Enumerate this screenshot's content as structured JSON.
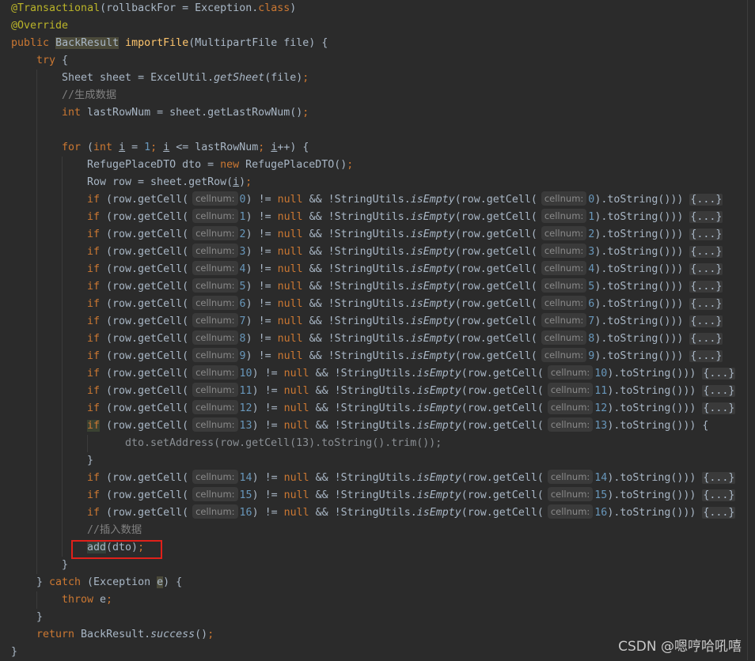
{
  "colors": {
    "background": "#2b2b2b",
    "keyword": "#cc7832",
    "annotation": "#bbb529",
    "method_decl": "#ffc66d",
    "text": "#a9b7c6",
    "number": "#6897bb",
    "comment": "#808080",
    "highlight_box": "#e0201a"
  },
  "watermark": "CSDN @嗯哼哈吼嘻",
  "lines": [
    {
      "indent": 0,
      "tokens": [
        [
          "ann",
          "@Transactional"
        ],
        [
          "p",
          "(rollbackFor = Exception."
        ],
        [
          "kw",
          "class"
        ],
        [
          "p",
          ")"
        ]
      ]
    },
    {
      "indent": 0,
      "tokens": [
        [
          "ann",
          "@Override"
        ]
      ]
    },
    {
      "indent": 0,
      "tokens": [
        [
          "kw",
          "public"
        ],
        [
          "p",
          " "
        ],
        [
          "hl",
          "BackResult"
        ],
        [
          "p",
          " "
        ],
        [
          "fn",
          "importFile"
        ],
        [
          "p",
          "(MultipartFile file) {"
        ]
      ]
    },
    {
      "indent": 1,
      "tokens": [
        [
          "kw",
          "try"
        ],
        [
          "p",
          " {"
        ]
      ]
    },
    {
      "indent": 2,
      "tokens": [
        [
          "p",
          "Sheet sheet = ExcelUtil."
        ],
        [
          "it",
          "getSheet"
        ],
        [
          "p",
          "(file)"
        ],
        [
          "kw",
          ";"
        ]
      ]
    },
    {
      "indent": 2,
      "tokens": [
        [
          "cm",
          "//生成数据"
        ]
      ]
    },
    {
      "indent": 2,
      "tokens": [
        [
          "kw",
          "int"
        ],
        [
          "p",
          " lastRowNum = sheet.getLastRowNum()"
        ],
        [
          "kw",
          ";"
        ]
      ]
    },
    {
      "indent": 2,
      "tokens": []
    },
    {
      "indent": 2,
      "tokens": [
        [
          "kw",
          "for"
        ],
        [
          "p",
          " ("
        ],
        [
          "kw",
          "int"
        ],
        [
          "p",
          " "
        ],
        [
          "ul",
          "i"
        ],
        [
          "p",
          " = "
        ],
        [
          "num",
          "1"
        ],
        [
          "kw",
          ";"
        ],
        [
          "p",
          " "
        ],
        [
          "ul",
          "i"
        ],
        [
          "p",
          " <= lastRowNum"
        ],
        [
          "kw",
          ";"
        ],
        [
          "p",
          " "
        ],
        [
          "ul",
          "i"
        ],
        [
          "p",
          "++) {"
        ]
      ]
    },
    {
      "indent": 3,
      "tokens": [
        [
          "p",
          "RefugePlaceDTO dto = "
        ],
        [
          "kw",
          "new"
        ],
        [
          "p",
          " RefugePlaceDTO()"
        ],
        [
          "kw",
          ";"
        ]
      ]
    },
    {
      "indent": 3,
      "tokens": [
        [
          "p",
          "Row row = sheet.getRow("
        ],
        [
          "ul",
          "i"
        ],
        [
          "p",
          ")"
        ],
        [
          "kw",
          ";"
        ]
      ]
    },
    {
      "indent": 3,
      "tokens": [
        [
          "kw",
          "if"
        ],
        [
          "p",
          " (row.getCell("
        ],
        [
          "hint",
          "cellnum:"
        ],
        [
          "num",
          "0"
        ],
        [
          "p",
          ") != "
        ],
        [
          "kw",
          "null"
        ],
        [
          "p",
          " && !StringUtils."
        ],
        [
          "it",
          "isEmpty"
        ],
        [
          "p",
          "(row.getCell("
        ],
        [
          "hint",
          "cellnum:"
        ],
        [
          "num",
          "0"
        ],
        [
          "p",
          ").toString())) "
        ],
        [
          "fold",
          "{...}"
        ]
      ]
    },
    {
      "indent": 3,
      "tokens": [
        [
          "kw",
          "if"
        ],
        [
          "p",
          " (row.getCell("
        ],
        [
          "hint",
          "cellnum:"
        ],
        [
          "num",
          "1"
        ],
        [
          "p",
          ") != "
        ],
        [
          "kw",
          "null"
        ],
        [
          "p",
          " && !StringUtils."
        ],
        [
          "it",
          "isEmpty"
        ],
        [
          "p",
          "(row.getCell("
        ],
        [
          "hint",
          "cellnum:"
        ],
        [
          "num",
          "1"
        ],
        [
          "p",
          ").toString())) "
        ],
        [
          "fold",
          "{...}"
        ]
      ]
    },
    {
      "indent": 3,
      "tokens": [
        [
          "kw",
          "if"
        ],
        [
          "p",
          " (row.getCell("
        ],
        [
          "hint",
          "cellnum:"
        ],
        [
          "num",
          "2"
        ],
        [
          "p",
          ") != "
        ],
        [
          "kw",
          "null"
        ],
        [
          "p",
          " && !StringUtils."
        ],
        [
          "it",
          "isEmpty"
        ],
        [
          "p",
          "(row.getCell("
        ],
        [
          "hint",
          "cellnum:"
        ],
        [
          "num",
          "2"
        ],
        [
          "p",
          ").toString())) "
        ],
        [
          "fold",
          "{...}"
        ]
      ]
    },
    {
      "indent": 3,
      "tokens": [
        [
          "kw",
          "if"
        ],
        [
          "p",
          " (row.getCell("
        ],
        [
          "hint",
          "cellnum:"
        ],
        [
          "num",
          "3"
        ],
        [
          "p",
          ") != "
        ],
        [
          "kw",
          "null"
        ],
        [
          "p",
          " && !StringUtils."
        ],
        [
          "it",
          "isEmpty"
        ],
        [
          "p",
          "(row.getCell("
        ],
        [
          "hint",
          "cellnum:"
        ],
        [
          "num",
          "3"
        ],
        [
          "p",
          ").toString())) "
        ],
        [
          "fold",
          "{...}"
        ]
      ]
    },
    {
      "indent": 3,
      "tokens": [
        [
          "kw",
          "if"
        ],
        [
          "p",
          " (row.getCell("
        ],
        [
          "hint",
          "cellnum:"
        ],
        [
          "num",
          "4"
        ],
        [
          "p",
          ") != "
        ],
        [
          "kw",
          "null"
        ],
        [
          "p",
          " && !StringUtils."
        ],
        [
          "it",
          "isEmpty"
        ],
        [
          "p",
          "(row.getCell("
        ],
        [
          "hint",
          "cellnum:"
        ],
        [
          "num",
          "4"
        ],
        [
          "p",
          ").toString())) "
        ],
        [
          "fold",
          "{...}"
        ]
      ]
    },
    {
      "indent": 3,
      "tokens": [
        [
          "kw",
          "if"
        ],
        [
          "p",
          " (row.getCell("
        ],
        [
          "hint",
          "cellnum:"
        ],
        [
          "num",
          "5"
        ],
        [
          "p",
          ") != "
        ],
        [
          "kw",
          "null"
        ],
        [
          "p",
          " && !StringUtils."
        ],
        [
          "it",
          "isEmpty"
        ],
        [
          "p",
          "(row.getCell("
        ],
        [
          "hint",
          "cellnum:"
        ],
        [
          "num",
          "5"
        ],
        [
          "p",
          ").toString())) "
        ],
        [
          "fold",
          "{...}"
        ]
      ]
    },
    {
      "indent": 3,
      "tokens": [
        [
          "kw",
          "if"
        ],
        [
          "p",
          " (row.getCell("
        ],
        [
          "hint",
          "cellnum:"
        ],
        [
          "num",
          "6"
        ],
        [
          "p",
          ") != "
        ],
        [
          "kw",
          "null"
        ],
        [
          "p",
          " && !StringUtils."
        ],
        [
          "it",
          "isEmpty"
        ],
        [
          "p",
          "(row.getCell("
        ],
        [
          "hint",
          "cellnum:"
        ],
        [
          "num",
          "6"
        ],
        [
          "p",
          ").toString())) "
        ],
        [
          "fold",
          "{...}"
        ]
      ]
    },
    {
      "indent": 3,
      "tokens": [
        [
          "kw",
          "if"
        ],
        [
          "p",
          " (row.getCell("
        ],
        [
          "hint",
          "cellnum:"
        ],
        [
          "num",
          "7"
        ],
        [
          "p",
          ") != "
        ],
        [
          "kw",
          "null"
        ],
        [
          "p",
          " && !StringUtils."
        ],
        [
          "it",
          "isEmpty"
        ],
        [
          "p",
          "(row.getCell("
        ],
        [
          "hint",
          "cellnum:"
        ],
        [
          "num",
          "7"
        ],
        [
          "p",
          ").toString())) "
        ],
        [
          "fold",
          "{...}"
        ]
      ]
    },
    {
      "indent": 3,
      "tokens": [
        [
          "kw",
          "if"
        ],
        [
          "p",
          " (row.getCell("
        ],
        [
          "hint",
          "cellnum:"
        ],
        [
          "num",
          "8"
        ],
        [
          "p",
          ") != "
        ],
        [
          "kw",
          "null"
        ],
        [
          "p",
          " && !StringUtils."
        ],
        [
          "it",
          "isEmpty"
        ],
        [
          "p",
          "(row.getCell("
        ],
        [
          "hint",
          "cellnum:"
        ],
        [
          "num",
          "8"
        ],
        [
          "p",
          ").toString())) "
        ],
        [
          "fold",
          "{...}"
        ]
      ]
    },
    {
      "indent": 3,
      "tokens": [
        [
          "kw",
          "if"
        ],
        [
          "p",
          " (row.getCell("
        ],
        [
          "hint",
          "cellnum:"
        ],
        [
          "num",
          "9"
        ],
        [
          "p",
          ") != "
        ],
        [
          "kw",
          "null"
        ],
        [
          "p",
          " && !StringUtils."
        ],
        [
          "it",
          "isEmpty"
        ],
        [
          "p",
          "(row.getCell("
        ],
        [
          "hint",
          "cellnum:"
        ],
        [
          "num",
          "9"
        ],
        [
          "p",
          ").toString())) "
        ],
        [
          "fold",
          "{...}"
        ]
      ]
    },
    {
      "indent": 3,
      "tokens": [
        [
          "kw",
          "if"
        ],
        [
          "p",
          " (row.getCell("
        ],
        [
          "hint",
          "cellnum:"
        ],
        [
          "num",
          "10"
        ],
        [
          "p",
          ") != "
        ],
        [
          "kw",
          "null"
        ],
        [
          "p",
          " && !StringUtils."
        ],
        [
          "it",
          "isEmpty"
        ],
        [
          "p",
          "(row.getCell("
        ],
        [
          "hint",
          "cellnum:"
        ],
        [
          "num",
          "10"
        ],
        [
          "p",
          ").toString())) "
        ],
        [
          "fold",
          "{...}"
        ]
      ]
    },
    {
      "indent": 3,
      "tokens": [
        [
          "kw",
          "if"
        ],
        [
          "p",
          " (row.getCell("
        ],
        [
          "hint",
          "cellnum:"
        ],
        [
          "num",
          "11"
        ],
        [
          "p",
          ") != "
        ],
        [
          "kw",
          "null"
        ],
        [
          "p",
          " && !StringUtils."
        ],
        [
          "it",
          "isEmpty"
        ],
        [
          "p",
          "(row.getCell("
        ],
        [
          "hint",
          "cellnum:"
        ],
        [
          "num",
          "11"
        ],
        [
          "p",
          ").toString())) "
        ],
        [
          "fold",
          "{...}"
        ]
      ]
    },
    {
      "indent": 3,
      "tokens": [
        [
          "kw",
          "if"
        ],
        [
          "p",
          " (row.getCell("
        ],
        [
          "hint",
          "cellnum:"
        ],
        [
          "num",
          "12"
        ],
        [
          "p",
          ") != "
        ],
        [
          "kw",
          "null"
        ],
        [
          "p",
          " && !StringUtils."
        ],
        [
          "it",
          "isEmpty"
        ],
        [
          "p",
          "(row.getCell("
        ],
        [
          "hint",
          "cellnum:"
        ],
        [
          "num",
          "12"
        ],
        [
          "p",
          ").toString())) "
        ],
        [
          "fold",
          "{...}"
        ]
      ]
    },
    {
      "indent": 3,
      "tokens": [
        [
          "hlk",
          "if"
        ],
        [
          "p",
          " (row.getCell("
        ],
        [
          "hint",
          "cellnum:"
        ],
        [
          "num",
          "13"
        ],
        [
          "p",
          ") != "
        ],
        [
          "kw",
          "null"
        ],
        [
          "p",
          " && !StringUtils."
        ],
        [
          "it",
          "isEmpty"
        ],
        [
          "p",
          "(row.getCell("
        ],
        [
          "hint",
          "cellnum:"
        ],
        [
          "num",
          "13"
        ],
        [
          "p",
          ").toString())) {"
        ]
      ]
    },
    {
      "indent": 4,
      "tokens": [
        [
          "dim",
          "  dto.setAddress(row.getCell(13).toString().trim());"
        ]
      ]
    },
    {
      "indent": 3,
      "tokens": [
        [
          "p",
          "}"
        ]
      ]
    },
    {
      "indent": 3,
      "tokens": [
        [
          "kw",
          "if"
        ],
        [
          "p",
          " (row.getCell("
        ],
        [
          "hint",
          "cellnum:"
        ],
        [
          "num",
          "14"
        ],
        [
          "p",
          ") != "
        ],
        [
          "kw",
          "null"
        ],
        [
          "p",
          " && !StringUtils."
        ],
        [
          "it",
          "isEmpty"
        ],
        [
          "p",
          "(row.getCell("
        ],
        [
          "hint",
          "cellnum:"
        ],
        [
          "num",
          "14"
        ],
        [
          "p",
          ").toString())) "
        ],
        [
          "fold",
          "{...}"
        ]
      ]
    },
    {
      "indent": 3,
      "tokens": [
        [
          "kw",
          "if"
        ],
        [
          "p",
          " (row.getCell("
        ],
        [
          "hint",
          "cellnum:"
        ],
        [
          "num",
          "15"
        ],
        [
          "p",
          ") != "
        ],
        [
          "kw",
          "null"
        ],
        [
          "p",
          " && !StringUtils."
        ],
        [
          "it",
          "isEmpty"
        ],
        [
          "p",
          "(row.getCell("
        ],
        [
          "hint",
          "cellnum:"
        ],
        [
          "num",
          "15"
        ],
        [
          "p",
          ").toString())) "
        ],
        [
          "fold",
          "{...}"
        ]
      ]
    },
    {
      "indent": 3,
      "tokens": [
        [
          "kw",
          "if"
        ],
        [
          "p",
          " (row.getCell("
        ],
        [
          "hint",
          "cellnum:"
        ],
        [
          "num",
          "16"
        ],
        [
          "p",
          ") != "
        ],
        [
          "kw",
          "null"
        ],
        [
          "p",
          " && !StringUtils."
        ],
        [
          "it",
          "isEmpty"
        ],
        [
          "p",
          "(row.getCell("
        ],
        [
          "hint",
          "cellnum:"
        ],
        [
          "num",
          "16"
        ],
        [
          "p",
          ").toString())) "
        ],
        [
          "fold",
          "{...}"
        ]
      ]
    },
    {
      "indent": 3,
      "tokens": [
        [
          "cm",
          "//插入数据"
        ]
      ]
    },
    {
      "indent": 3,
      "tokens": [
        [
          "hlg",
          "add"
        ],
        [
          "p",
          "(dto)"
        ],
        [
          "kw",
          ";"
        ]
      ]
    },
    {
      "indent": 2,
      "tokens": [
        [
          "p",
          "}"
        ]
      ]
    },
    {
      "indent": 1,
      "tokens": [
        [
          "p",
          "} "
        ],
        [
          "kw",
          "catch"
        ],
        [
          "p",
          " (Exception "
        ],
        [
          "hl",
          "e"
        ],
        [
          "p",
          ") {"
        ]
      ]
    },
    {
      "indent": 2,
      "tokens": [
        [
          "kw",
          "throw"
        ],
        [
          "p",
          " e"
        ],
        [
          "kw",
          ";"
        ]
      ]
    },
    {
      "indent": 1,
      "tokens": [
        [
          "p",
          "}"
        ]
      ]
    },
    {
      "indent": 1,
      "tokens": [
        [
          "kw",
          "return"
        ],
        [
          "p",
          " BackResult."
        ],
        [
          "it",
          "success"
        ],
        [
          "p",
          "()"
        ],
        [
          "kw",
          ";"
        ]
      ]
    },
    {
      "indent": 0,
      "tokens": [
        [
          "p",
          "}"
        ]
      ]
    }
  ]
}
